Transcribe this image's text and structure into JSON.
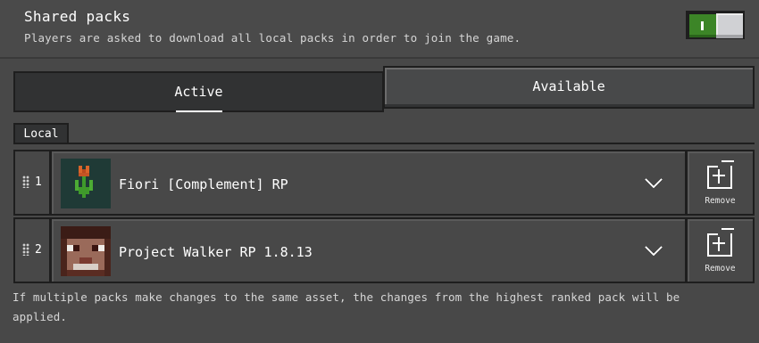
{
  "shared_packs": {
    "title": "Shared packs",
    "description": "Players are asked to download all local packs in order to join the game.",
    "toggle_on": true
  },
  "tabs": {
    "active_label": "Active",
    "available_label": "Available"
  },
  "local_label": "Local",
  "packs": [
    {
      "rank": "1",
      "name": "Fiori [Complement] RP",
      "remove_label": "Remove",
      "icon": "tulip-flower-icon"
    },
    {
      "rank": "2",
      "name": "Project Walker RP 1.8.13",
      "remove_label": "Remove",
      "icon": "zombie-face-icon"
    }
  ],
  "footer_note": "If multiple packs make changes to the same asset, the changes from the highest ranked pack will be applied.",
  "colors": {
    "toggle_on": "#3c8527",
    "background": "#484848",
    "border": "#1e1e1e"
  }
}
